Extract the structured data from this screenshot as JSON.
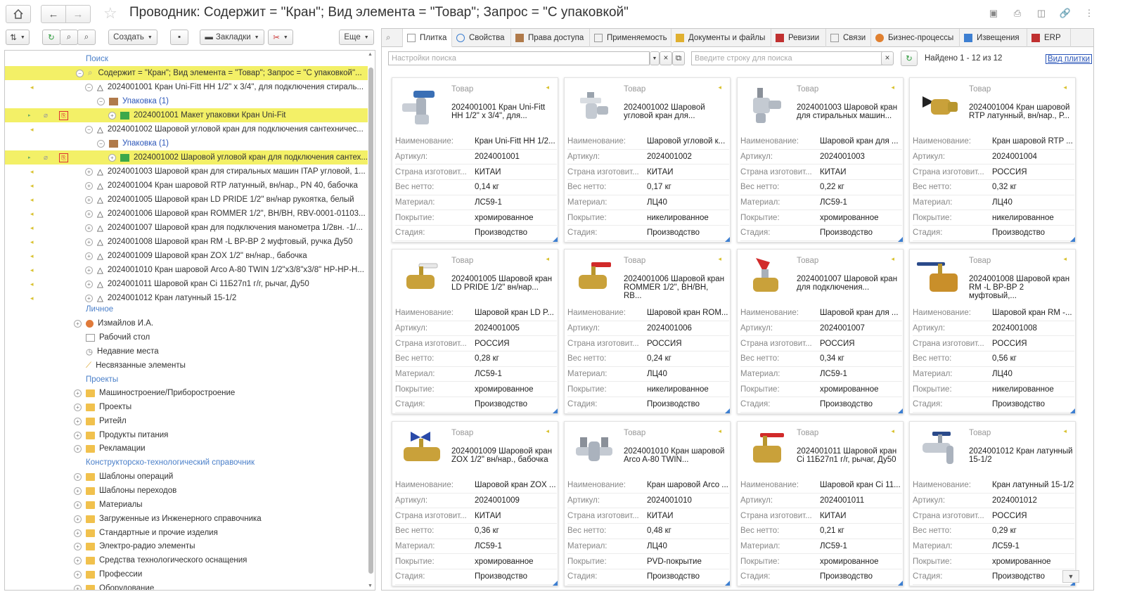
{
  "window": {
    "title": "Проводник: Содержит = \"Кран\"; Вид элемента = \"Товар\"; Запрос = \"С упаковкой\""
  },
  "toolbar": {
    "create_label": "Создать",
    "bookmarks_label": "Закладки",
    "more_label": "Еще"
  },
  "tree": {
    "sections": {
      "search": "Поиск",
      "personal": "Личное",
      "projects": "Проекты",
      "reference": "Конструкторско-технологический справочник"
    },
    "query_row": "Содержит = \"Кран\"; Вид элемента = \"Товар\"; Запрос = \"С упаковкой\"...",
    "items": [
      {
        "label": "2024001001 Кран Uni-Fitt НН 1/2\" х 3/4\", для подключения стираль..."
      },
      {
        "label": "Упаковка (1)"
      },
      {
        "label": "2024001001 Макет упаковки Кран Uni-Fit"
      },
      {
        "label": "2024001002 Шаровой угловой кран для подключения сантехничес..."
      },
      {
        "label": "Упаковка (1)"
      },
      {
        "label": "2024001002 Шаровой угловой кран для подключения сантех..."
      },
      {
        "label": "2024001003 Шаровой кран для стиральных машин ITAP угловой, 1..."
      },
      {
        "label": "2024001004 Кран шаровой RTP латунный, вн/нар., PN 40, бабочка"
      },
      {
        "label": "2024001005 Шаровой кран LD PRIDE 1/2\" вн/нар рукоятка, белый"
      },
      {
        "label": "2024001006 Шаровой кран ROMMER 1/2\", ВН/ВН, RBV-0001-01103..."
      },
      {
        "label": "2024001007 Шаровой кран для подключения манометра 1/2вн. -1/..."
      },
      {
        "label": "2024001008 Шаровой кран RM -L ВР-ВР 2 муфтовый, ручка Ду50"
      },
      {
        "label": "2024001009 Шаровой кран ZOX 1/2\" вн/нар., бабочка"
      },
      {
        "label": "2024001010 Кран шаровой Arco A-80 TWIN 1/2\"x3/8\"x3/8\" НР-НР-Н..."
      },
      {
        "label": "2024001011 Шаровой кран Ci 11Б27п1 г/г, рычаг, Ду50"
      },
      {
        "label": "2024001012 Кран латунный 15-1/2"
      }
    ],
    "personal_items": [
      "Измайлов И.А.",
      "Рабочий стол",
      "Недавние места",
      "Несвязанные элементы"
    ],
    "project_items": [
      "Машиностроение/Приборостроение",
      "Проекты",
      "Ритейл",
      "Продукты питания",
      "Рекламации"
    ],
    "reference_items": [
      "Шаблоны операций",
      "Шаблоны переходов",
      "Материалы",
      "Загруженные из Инженерного справочника",
      "Стандартные и прочие изделия",
      "Электро-радио элементы",
      "Средства технологического оснащения",
      "Профессии",
      "Оборудование"
    ]
  },
  "tabs": [
    "Плитка",
    "Свойства",
    "Права доступа",
    "Применяемость",
    "Документы и файлы",
    "Ревизии",
    "Связи",
    "Бизнес-процессы",
    "Извещения",
    "ERP"
  ],
  "search": {
    "settings_placeholder": "Настройки поиска",
    "query_placeholder": "Введите строку для поиска",
    "found": "Найдено 1 - 12 из 12",
    "view_link": "Вид плитки"
  },
  "prop_labels": [
    "Наименование:",
    "Артикул:",
    "Страна изготовит...",
    "Вес нетто:",
    "Материал:",
    "Покрытие:",
    "Стадия:"
  ],
  "card_type": "Товар",
  "cards": [
    {
      "name": "2024001001 Кран Uni-Fitt НН 1/2\" х 3/4\", для...",
      "values": [
        "Кран Uni-Fitt НН 1/2...",
        "2024001001",
        "КИТАЙ",
        "0,14 кг",
        "ЛС59-1",
        "хромированное",
        "Производство"
      ]
    },
    {
      "name": "2024001002 Шаровой угловой кран для...",
      "values": [
        "Шаровой угловой к...",
        "2024001002",
        "КИТАЙ",
        "0,17 кг",
        "ЛЦ40",
        "никелированное",
        "Производство"
      ]
    },
    {
      "name": "2024001003 Шаровой кран для стиральных машин...",
      "values": [
        "Шаровой кран для ...",
        "2024001003",
        "КИТАЙ",
        "0,22 кг",
        "ЛС59-1",
        "хромированное",
        "Производство"
      ]
    },
    {
      "name": "2024001004 Кран шаровой RTP латунный, вн/нар., Р...",
      "values": [
        "Кран шаровой RTP ...",
        "2024001004",
        "РОССИЯ",
        "0,32 кг",
        "ЛЦ40",
        "никелированное",
        "Производство"
      ]
    },
    {
      "name": "2024001005 Шаровой кран LD PRIDE 1/2\" вн/нар...",
      "values": [
        "Шаровой кран LD P...",
        "2024001005",
        "РОССИЯ",
        "0,28 кг",
        "ЛС59-1",
        "хромированное",
        "Производство"
      ]
    },
    {
      "name": "2024001006 Шаровой кран ROMMER 1/2\", ВН/ВН, RB...",
      "values": [
        "Шаровой кран ROM...",
        "2024001006",
        "РОССИЯ",
        "0,24 кг",
        "ЛЦ40",
        "никелированное",
        "Производство"
      ]
    },
    {
      "name": "2024001007 Шаровой кран для подключения...",
      "values": [
        "Шаровой кран для ...",
        "2024001007",
        "РОССИЯ",
        "0,34 кг",
        "ЛС59-1",
        "хромированное",
        "Производство"
      ]
    },
    {
      "name": "2024001008 Шаровой кран RM -L ВР-ВР 2 муфтовый,...",
      "values": [
        "Шаровой кран RM -...",
        "2024001008",
        "РОССИЯ",
        "0,56 кг",
        "ЛЦ40",
        "никелированное",
        "Производство"
      ]
    },
    {
      "name": "2024001009 Шаровой кран ZOX 1/2\" вн/нар., бабочка",
      "values": [
        "Шаровой кран ZOX ...",
        "2024001009",
        "КИТАЙ",
        "0,36 кг",
        "ЛС59-1",
        "хромированное",
        "Производство"
      ]
    },
    {
      "name": "2024001010 Кран шаровой Arco A-80 TWIN...",
      "values": [
        "Кран шаровой Arco ...",
        "2024001010",
        "КИТАЙ",
        "0,48 кг",
        "ЛЦ40",
        "PVD-покрытие",
        "Производство"
      ]
    },
    {
      "name": "2024001011 Шаровой кран Ci 11Б27п1 г/г, рычаг, Ду50",
      "values": [
        "Шаровой кран Ci 11...",
        "2024001011",
        "КИТАЙ",
        "0,21 кг",
        "ЛС59-1",
        "хромированное",
        "Производство"
      ]
    },
    {
      "name": "2024001012 Кран латунный 15-1/2",
      "values": [
        "Кран латунный 15-1/2",
        "2024001012",
        "РОССИЯ",
        "0,29 кг",
        "ЛС59-1",
        "хромированное",
        "Производство"
      ]
    }
  ],
  "colors": {
    "highlight": "#f3f067",
    "section_link": "#4a7fc9",
    "accent_corner": "#3d7fd1",
    "folder": "#f1c14d"
  }
}
